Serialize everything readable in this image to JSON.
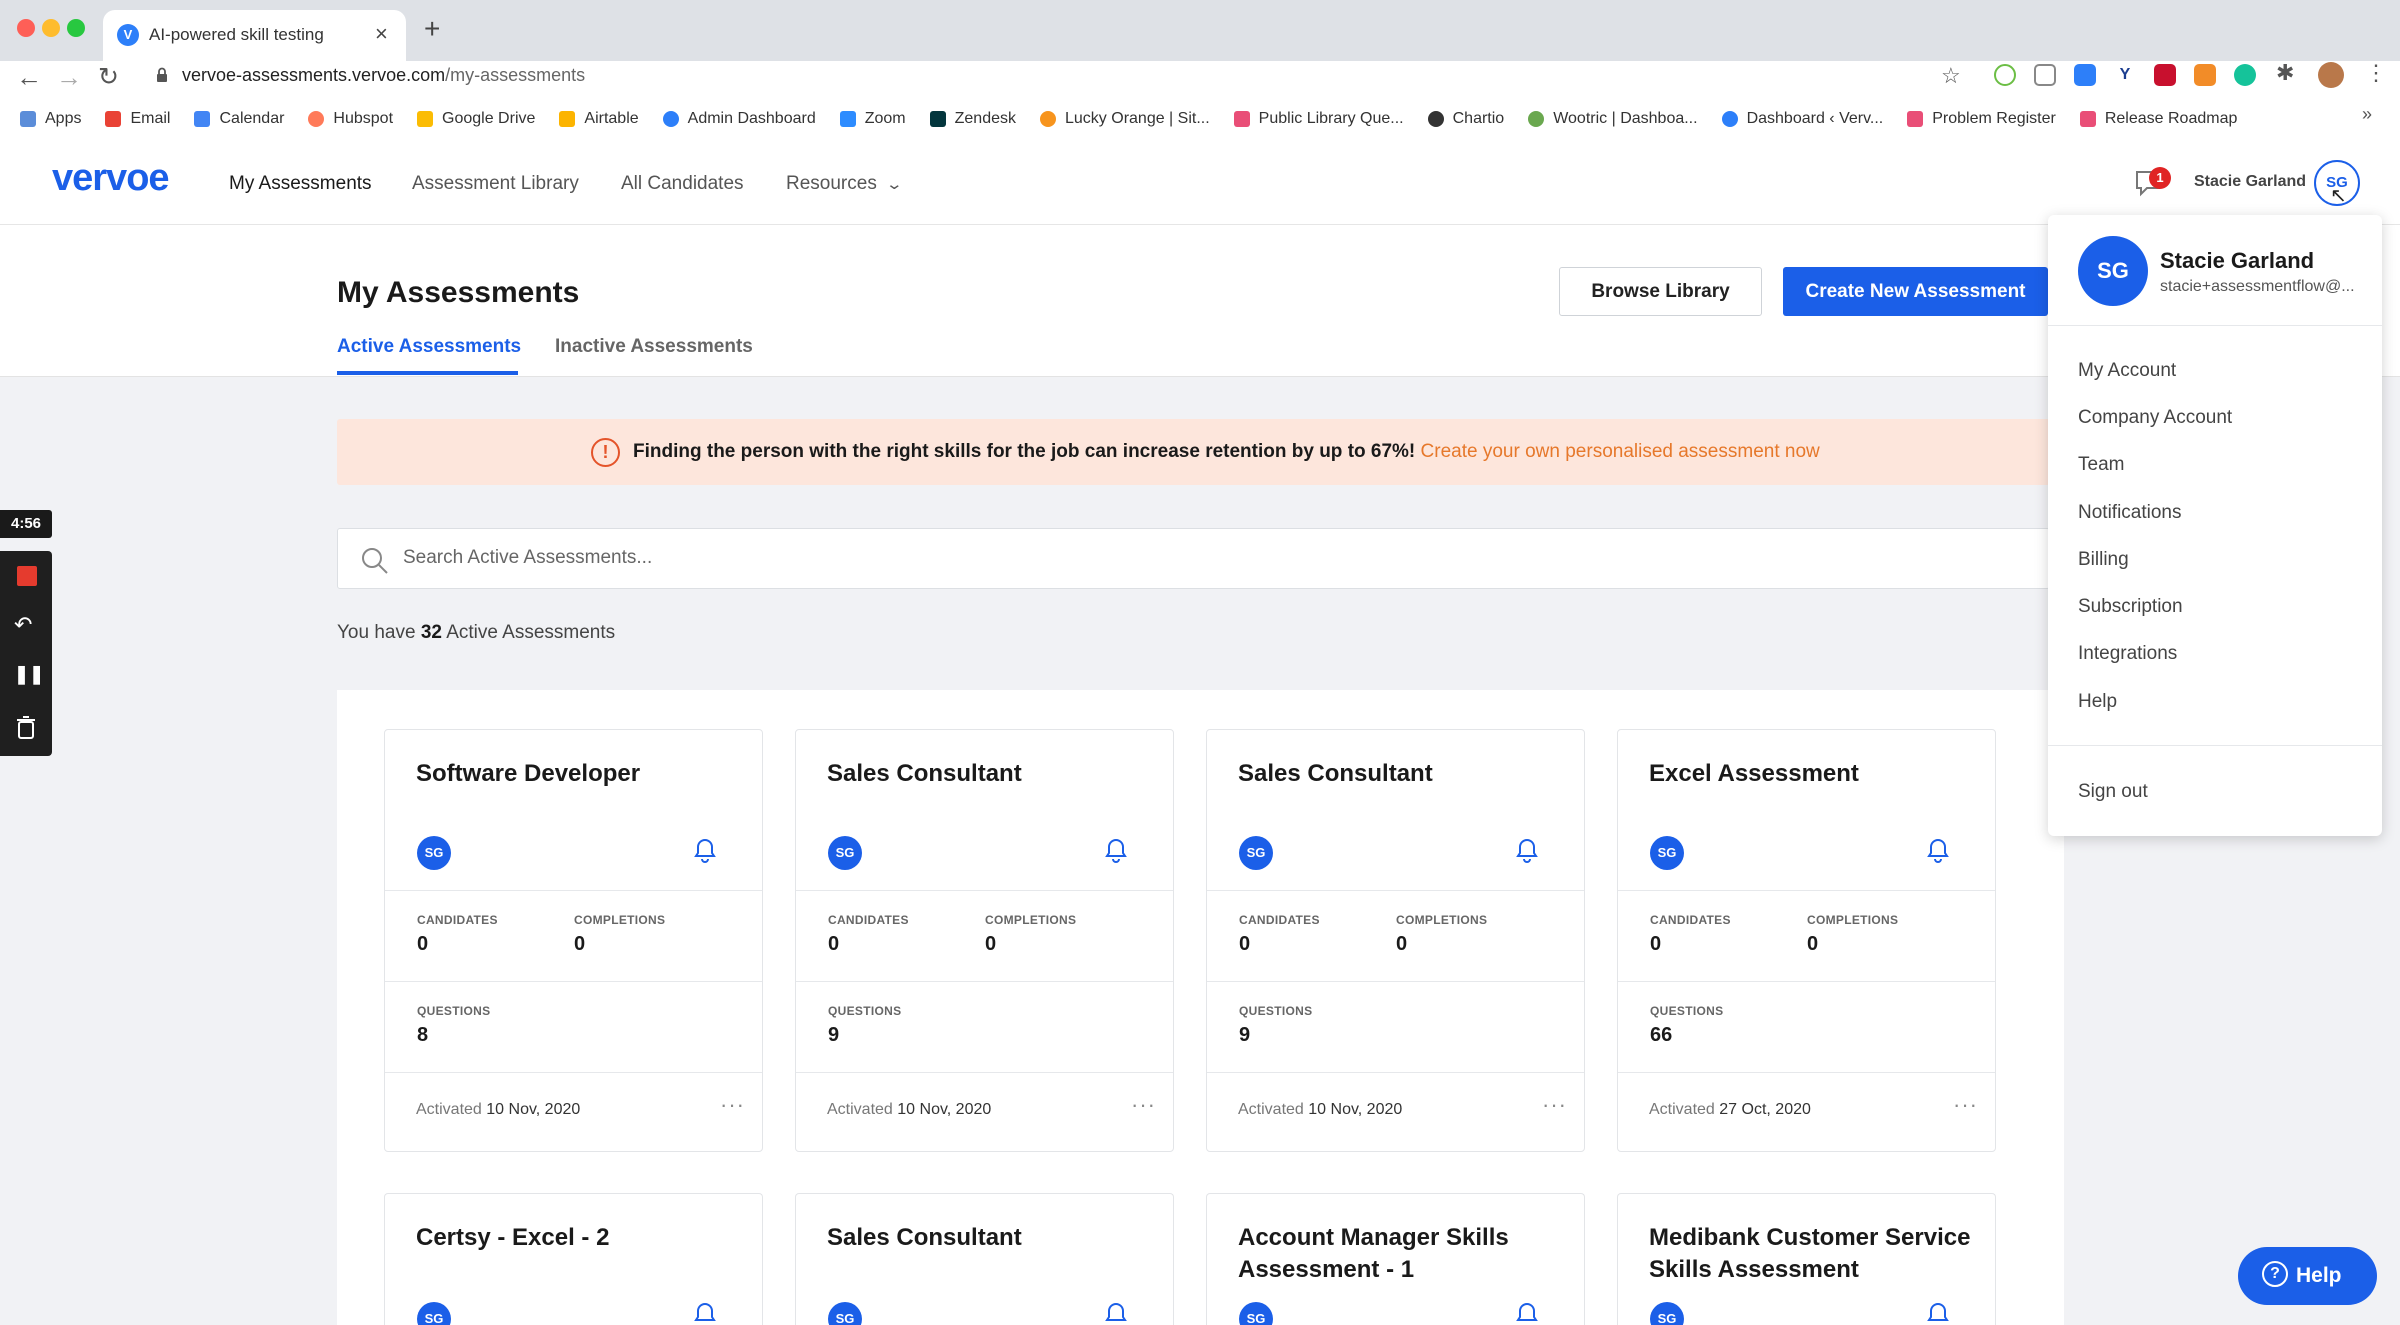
{
  "browser": {
    "tab_title": "AI-powered skill testing",
    "tab_favicon": "V",
    "url_domain": "vervoe-assessments.vervoe.com",
    "url_path": "/my-assessments",
    "bookmarks": [
      "Apps",
      "Email",
      "Calendar",
      "Hubspot",
      "Google Drive",
      "Airtable",
      "Admin Dashboard",
      "Zoom",
      "Zendesk",
      "Lucky Orange | Sit...",
      "Public Library Que...",
      "Chartio",
      "Wootric | Dashboa...",
      "Dashboard ‹ Verv...",
      "Problem Register",
      "Release Roadmap"
    ],
    "bookmark_more": "»"
  },
  "app": {
    "logo": "vervoe",
    "nav": {
      "my_assessments": "My Assessments",
      "assessment_library": "Assessment Library",
      "all_candidates": "All Candidates",
      "resources": "Resources"
    },
    "notification_count": "1",
    "user_name": "Stacie Garland",
    "user_initials": "SG"
  },
  "page": {
    "title": "My Assessments",
    "browse_library": "Browse Library",
    "create_new": "Create New Assessment",
    "tabs": {
      "active": "Active Assessments",
      "inactive": "Inactive Assessments"
    },
    "banner_text": "Finding the person with the right skills for the job can increase retention by up to 67%!",
    "banner_link": "Create your own personalised assessment now",
    "search_placeholder": "Search Active Assessments...",
    "count_prefix": "You have",
    "count_value": "32",
    "count_suffix": "Active Assessments"
  },
  "card_labels": {
    "candidates": "CANDIDATES",
    "completions": "COMPLETIONS",
    "questions": "QUESTIONS",
    "activated": "Activated",
    "more": "···"
  },
  "cards": [
    {
      "title": "Software Developer",
      "owner": "SG",
      "candidates": "0",
      "completions": "0",
      "questions": "8",
      "activated": "10 Nov, 2020"
    },
    {
      "title": "Sales Consultant",
      "owner": "SG",
      "candidates": "0",
      "completions": "0",
      "questions": "9",
      "activated": "10 Nov, 2020"
    },
    {
      "title": "Sales Consultant",
      "owner": "SG",
      "candidates": "0",
      "completions": "0",
      "questions": "9",
      "activated": "10 Nov, 2020"
    },
    {
      "title": "Excel Assessment",
      "owner": "SG",
      "candidates": "0",
      "completions": "0",
      "questions": "66",
      "activated": "27 Oct, 2020"
    },
    {
      "title": "Certsy - Excel - 2",
      "owner": "SG"
    },
    {
      "title": "Sales Consultant",
      "owner": "SG"
    },
    {
      "title": "Account Manager Skills Assessment - 1",
      "owner": "SG"
    },
    {
      "title": "Medibank Customer Service Skills Assessment",
      "owner": "SG"
    }
  ],
  "dropdown": {
    "initials": "SG",
    "name": "Stacie Garland",
    "email": "stacie+assessmentflow@...",
    "items": [
      "My Account",
      "Company Account",
      "Team",
      "Notifications",
      "Billing",
      "Subscription",
      "Integrations",
      "Help"
    ],
    "sign_out": "Sign out"
  },
  "recorder": {
    "time": "4:56"
  },
  "help_button": "Help",
  "colors": {
    "brand_blue": "#1b5fe8",
    "banner_bg": "#fde6dc",
    "banner_link": "#e6782b",
    "badge_red": "#e02424"
  }
}
